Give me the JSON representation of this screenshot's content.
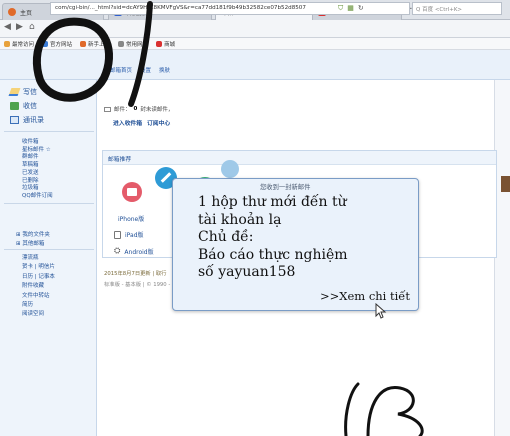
{
  "browser": {
    "tabs": [
      {
        "label": "主页",
        "active": false
      },
      {
        "label": "百度搜索",
        "active": false
      },
      {
        "label": "邮箱",
        "active": true
      },
      {
        "label": "",
        "active": false
      }
    ],
    "new_tab_symbol": "+",
    "address": "com/cgi-bin/..._html?sid=dcAY9HrC8KMVFgVS&r=ca77dd181f9b49b32582ce07b52d8507",
    "search_placeholder": "Q 百度 <Ctrl+K>"
  },
  "bookmarks": [
    "最常访问",
    "官方网站",
    "新手上路",
    "常用网址",
    "商城"
  ],
  "mail_header": {
    "links": [
      "邮箱首页",
      "设置",
      "换肤"
    ]
  },
  "sidebar": {
    "compose": "写信",
    "inbox": "收信",
    "contacts": "通讯录",
    "folders": [
      "收件箱",
      "星标邮件 ☆",
      "群邮件",
      "草稿箱",
      "已发送",
      "已删除",
      "垃圾箱",
      "QQ邮件订阅"
    ],
    "my_folders": "⊞ 我的文件夹",
    "other_mail": "⊞ 其他邮箱",
    "tools": [
      "漂流瓶",
      "贺卡 | 明信片",
      "日历 | 记事本",
      "附件收藏",
      "文件中转站",
      "简历",
      "阅读空间"
    ]
  },
  "main": {
    "mail_status_prefix": "邮件：",
    "mail_unread_count": "0",
    "mail_status_suffix": "封未读邮件，",
    "quick_links": [
      "进入收件箱",
      "订阅中心"
    ],
    "panel_title": "邮箱推荐",
    "devices": [
      "iPhone版",
      "iPad版",
      "Android版"
    ],
    "footer_date": "2015年8月7日更新 | 取行",
    "footer_links": "标准版 - 基本版 | © 1990 -"
  },
  "popup": {
    "title": "您收到一封新邮件",
    "lines": [
      "1 hộp thư mới đến từ",
      "tài khoản lạ",
      "Chủ đề:",
      "Báo cáo thực nghiệm",
      "số yayuan158"
    ],
    "link": ">>Xem chi tiết"
  },
  "colors": {
    "accent": "#1f4f96",
    "popup_border": "#7a9cc6",
    "popup_bg": "#eaf2fb",
    "header_bg": "#e9f1fa"
  }
}
